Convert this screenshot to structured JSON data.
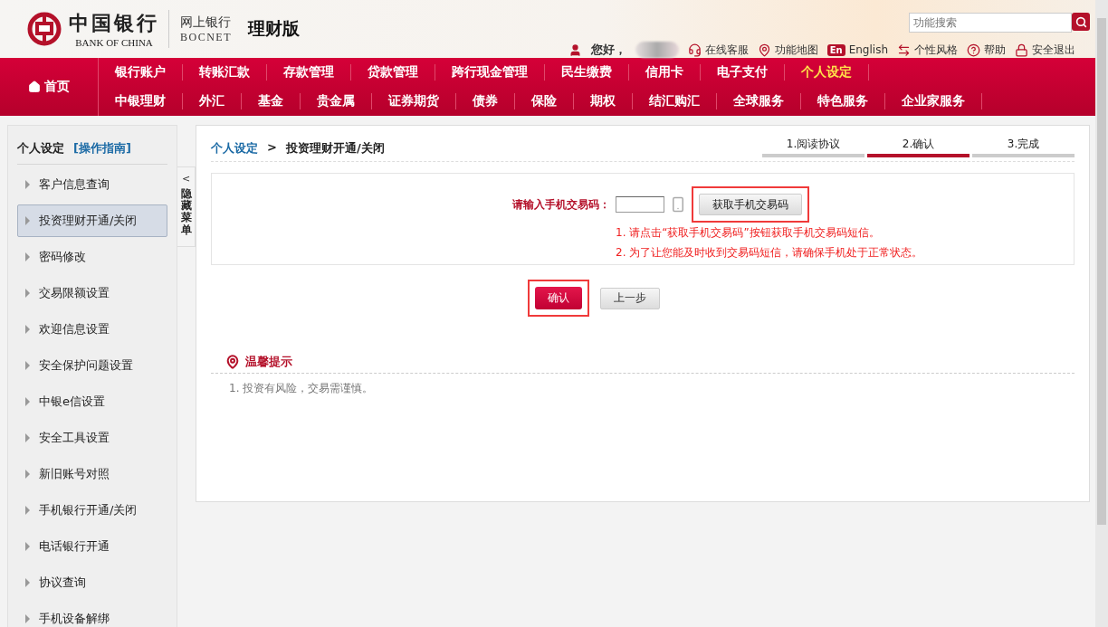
{
  "header": {
    "logo_cn": "中国银行",
    "logo_en": "BANK OF CHINA",
    "product_cn": "网上银行",
    "product_en": "BOCNET",
    "edition": "理财版",
    "search": {
      "placeholder": "功能搜索"
    },
    "greeting": "您好，",
    "links": [
      {
        "kind": "support",
        "label": "在线客服"
      },
      {
        "kind": "map",
        "label": "功能地图"
      },
      {
        "kind": "language",
        "badge": "En",
        "label": "English"
      },
      {
        "kind": "style",
        "label": "个性风格"
      },
      {
        "kind": "help",
        "label": "帮助"
      },
      {
        "kind": "logout",
        "label": "安全退出"
      }
    ]
  },
  "nav": {
    "home": "首页",
    "primary": [
      {
        "label": "银行账户",
        "selected": false
      },
      {
        "label": "转账汇款",
        "selected": false
      },
      {
        "label": "存款管理",
        "selected": false
      },
      {
        "label": "贷款管理",
        "selected": false
      },
      {
        "label": "跨行现金管理",
        "selected": false
      },
      {
        "label": "民生缴费",
        "selected": false
      },
      {
        "label": "信用卡",
        "selected": false
      },
      {
        "label": "电子支付",
        "selected": false
      },
      {
        "label": "个人设定",
        "selected": true
      }
    ],
    "secondary": [
      {
        "label": "中银理财",
        "selected": false
      },
      {
        "label": "外汇",
        "selected": false
      },
      {
        "label": "基金",
        "selected": false
      },
      {
        "label": "贵金属",
        "selected": false
      },
      {
        "label": "证券期货",
        "selected": false
      },
      {
        "label": "债券",
        "selected": false
      },
      {
        "label": "保险",
        "selected": false
      },
      {
        "label": "期权",
        "selected": false
      },
      {
        "label": "结汇购汇",
        "selected": false
      },
      {
        "label": "全球服务",
        "selected": false
      },
      {
        "label": "特色服务",
        "selected": false
      },
      {
        "label": "企业家服务",
        "selected": false
      }
    ]
  },
  "sidebar": {
    "title": "个人设定",
    "guide": "[操作指南]",
    "items": [
      {
        "label": "客户信息查询",
        "selected": false
      },
      {
        "label": "投资理财开通/关闭",
        "selected": true
      },
      {
        "label": "密码修改",
        "selected": false
      },
      {
        "label": "交易限额设置",
        "selected": false
      },
      {
        "label": "欢迎信息设置",
        "selected": false
      },
      {
        "label": "安全保护问题设置",
        "selected": false
      },
      {
        "label": "中银e信设置",
        "selected": false
      },
      {
        "label": "安全工具设置",
        "selected": false
      },
      {
        "label": "新旧账号对照",
        "selected": false
      },
      {
        "label": "手机银行开通/关闭",
        "selected": false
      },
      {
        "label": "电话银行开通",
        "selected": false
      },
      {
        "label": "协议查询",
        "selected": false
      },
      {
        "label": "手机设备解绑",
        "selected": false
      }
    ],
    "hide_toggle": {
      "arrow": "<",
      "label": "隐藏菜单"
    }
  },
  "main": {
    "breadcrumb": {
      "parent": "个人设定",
      "separator": ">",
      "current": "投资理财开通/关闭"
    },
    "steps": [
      {
        "label": "1.阅读协议",
        "selected": false
      },
      {
        "label": "2.确认",
        "selected": true
      },
      {
        "label": "3.完成",
        "selected": false
      }
    ],
    "form": {
      "label": "请输入手机交易码：",
      "get_code_button": {
        "label": "获取手机交易码",
        "highlighted": true
      },
      "notes": [
        "1. 请点击“获取手机交易码”按钮获取手机交易码短信。",
        "2. 为了让您能及时收到交易码短信，请确保手机处于正常状态。"
      ]
    },
    "buttons": [
      {
        "kind": "primary",
        "label": "确认",
        "highlighted": true
      },
      {
        "kind": "secondary",
        "label": "上一步",
        "highlighted": false
      }
    ],
    "tips": {
      "title": "温馨提示",
      "items": [
        "1. 投资有风险，交易需谨慎。"
      ]
    }
  }
}
